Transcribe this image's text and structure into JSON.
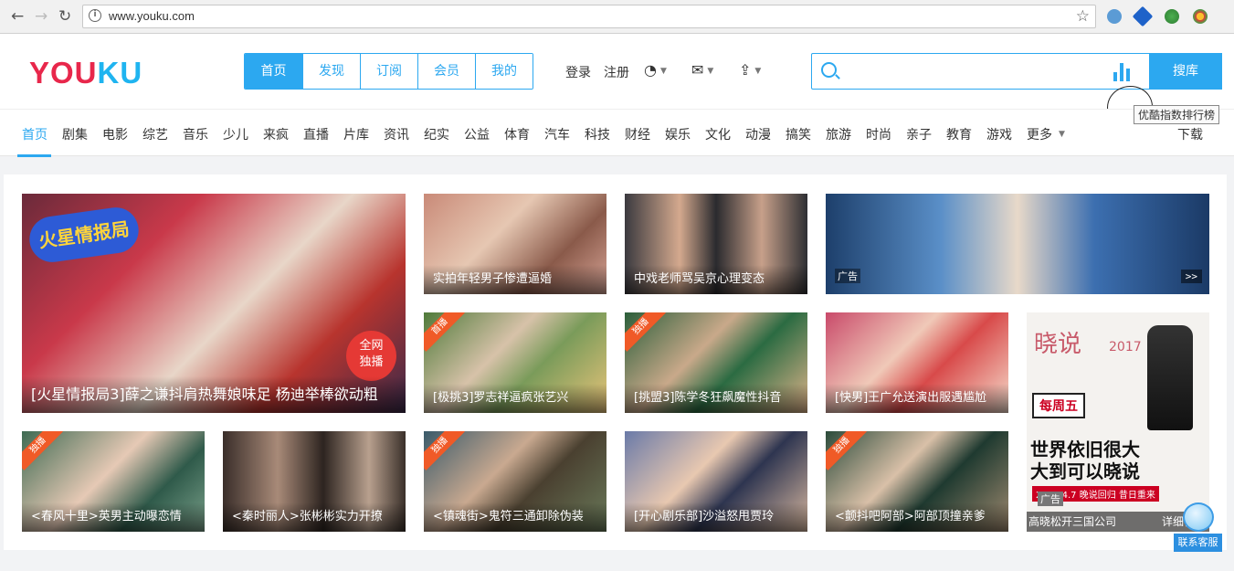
{
  "browser": {
    "url": "www.youku.com",
    "back": "←",
    "forward": "→",
    "reload": "↻",
    "info": "i",
    "bookmark": "☆"
  },
  "header": {
    "logo_red": "YOU",
    "logo_blue": "KU",
    "tabs": [
      "首页",
      "发现",
      "订阅",
      "会员",
      "我的"
    ],
    "login": "登录",
    "register": "注册",
    "search_button": "搜库",
    "search_placeholder": "",
    "tooltip": "优酷指数排行榜"
  },
  "channels": {
    "items": [
      "首页",
      "剧集",
      "电影",
      "综艺",
      "音乐",
      "少儿",
      "来疯",
      "直播",
      "片库",
      "资讯",
      "纪实",
      "公益",
      "体育",
      "汽车",
      "科技",
      "财经",
      "娱乐",
      "文化",
      "动漫",
      "搞笑",
      "旅游",
      "时尚",
      "亲子",
      "教育",
      "游戏",
      "更多"
    ],
    "download": "下载"
  },
  "cards": {
    "big": {
      "title": "[火星情报局3]薛之谦抖肩热舞娘味足 杨迪举棒欲动粗"
    },
    "c1": {
      "title": "实拍年轻男子惨遭逼婚"
    },
    "c2": {
      "title": "中戏老师骂吴京心理变态"
    },
    "c3": {
      "ad": "广告",
      "more": ">>"
    },
    "c4": {
      "title": "[极挑3]罗志祥逼疯张艺兴",
      "badge": "首播"
    },
    "c5": {
      "title": "[挑盟3]陈学冬狂飙魔性抖音",
      "badge": "独播"
    },
    "c6": {
      "title": "[快男]王广允送演出服遇尴尬"
    },
    "c7": {
      "title": "<春风十里>英男主动曝恋情",
      "badge": "独播"
    },
    "c8": {
      "title": "<秦时丽人>张彬彬实力开撩"
    },
    "c9": {
      "title": "<镇魂街>鬼符三通卸除伪装",
      "badge": "独播"
    },
    "c10": {
      "title": "[开心剧乐部]沙溢怒甩贾玲"
    },
    "c11": {
      "title": "<颤抖吧阿部>阿部顶撞亲爹",
      "badge": "独播"
    }
  },
  "side_ad": {
    "ad": "广告",
    "left": "高晓松开三国公司",
    "right": "详细信息",
    "headline1": "世界依旧很大",
    "headline2": "大到可以晓说",
    "date_line": "2017.4.7 晚说回归 昔日重来",
    "weekday": "每周五",
    "brand": "晓说",
    "year": "2017"
  },
  "service": {
    "label": "联系客服"
  },
  "colors": {
    "accent": "#2ca8f0",
    "logo_red": "#e8274b",
    "badge": "#f05a27"
  }
}
